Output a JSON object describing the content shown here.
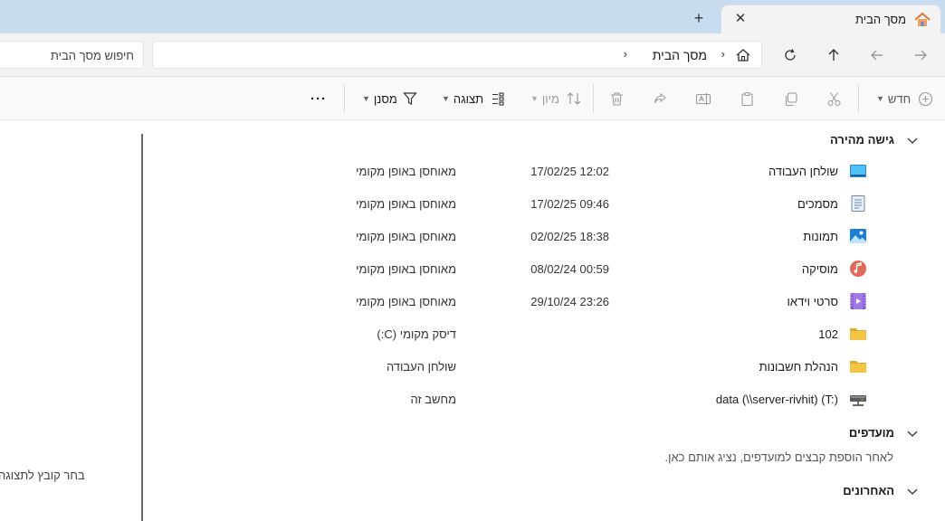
{
  "tab": {
    "title": "מסך הבית",
    "close_glyph": "✕",
    "new_tab_glyph": "+"
  },
  "address": {
    "crumb": "מסך הבית",
    "sep": "›",
    "search_placeholder": "חיפוש מסך הבית"
  },
  "toolbar": {
    "new_label": "חדש",
    "sort_label": "מיון",
    "view_label": "תצוגה",
    "filter_label": "מסנן",
    "more_glyph": "···"
  },
  "left_pane": {
    "hint": "בחר קובץ לתצוגה"
  },
  "sections": {
    "quick_access": "גישה מהירה",
    "favorites": "מועדפים",
    "favorites_hint": "לאחר הוספת קבצים למועדפים, נציג אותם כאן.",
    "recent": "האחרונים"
  },
  "quick_access_items": [
    {
      "name": "שולחן העבודה",
      "date": "17/02/25 12:02",
      "location": "מאוחסן באופן מקומי",
      "icon": "desktop-icon"
    },
    {
      "name": "מסמכים",
      "date": "17/02/25 09:46",
      "location": "מאוחסן באופן מקומי",
      "icon": "documents-icon"
    },
    {
      "name": "תמונות",
      "date": "02/02/25 18:38",
      "location": "מאוחסן באופן מקומי",
      "icon": "pictures-icon"
    },
    {
      "name": "מוסיקה",
      "date": "08/02/24 00:59",
      "location": "מאוחסן באופן מקומי",
      "icon": "music-icon"
    },
    {
      "name": "סרטי וידאו",
      "date": "29/10/24 23:26",
      "location": "מאוחסן באופן מקומי",
      "icon": "videos-icon"
    },
    {
      "name": "102",
      "date": "",
      "location": "דיסק מקומי (C:)",
      "icon": "folder-icon"
    },
    {
      "name": "הנהלת חשבונות",
      "date": "",
      "location": "שולחן העבודה",
      "icon": "folder-icon"
    },
    {
      "name": "data (\\\\server-rivhit) (T:)",
      "date": "",
      "location": "מחשב זה",
      "icon": "network-drive-icon"
    }
  ],
  "colors": {
    "tabstrip": "#c9dcef",
    "folder": "#f4c542",
    "accent": "#0067c0"
  }
}
